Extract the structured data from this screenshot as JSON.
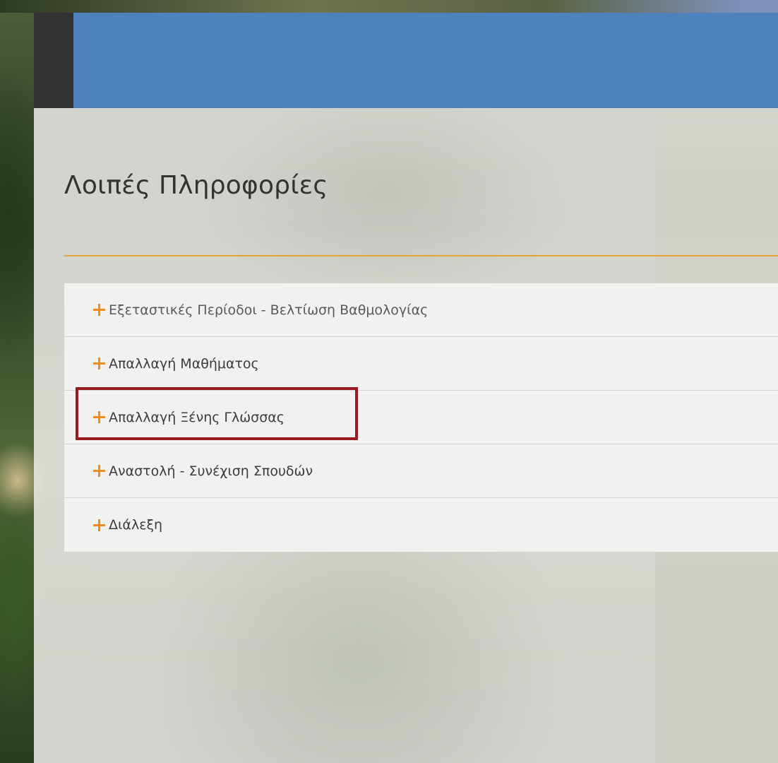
{
  "page": {
    "title": "Λοιπές Πληροφορίες"
  },
  "colors": {
    "header": "#4f81bd",
    "accent": "#e8a33d",
    "plus_icon": "#f08b1d",
    "highlight": "#9a1b1f"
  },
  "accordion": {
    "items": [
      {
        "label": "Εξεταστικές Περίοδοι - Βελτίωση Βαθμολογίας",
        "icon": "plus-icon"
      },
      {
        "label": "Απαλλαγή Μαθήματος",
        "icon": "plus-icon"
      },
      {
        "label": "Απαλλαγή Ξένης Γλώσσας",
        "icon": "plus-icon",
        "highlighted": true
      },
      {
        "label": "Αναστολή - Συνέχιση Σπουδών",
        "icon": "plus-icon"
      },
      {
        "label": "Διάλεξη",
        "icon": "plus-icon"
      }
    ]
  }
}
